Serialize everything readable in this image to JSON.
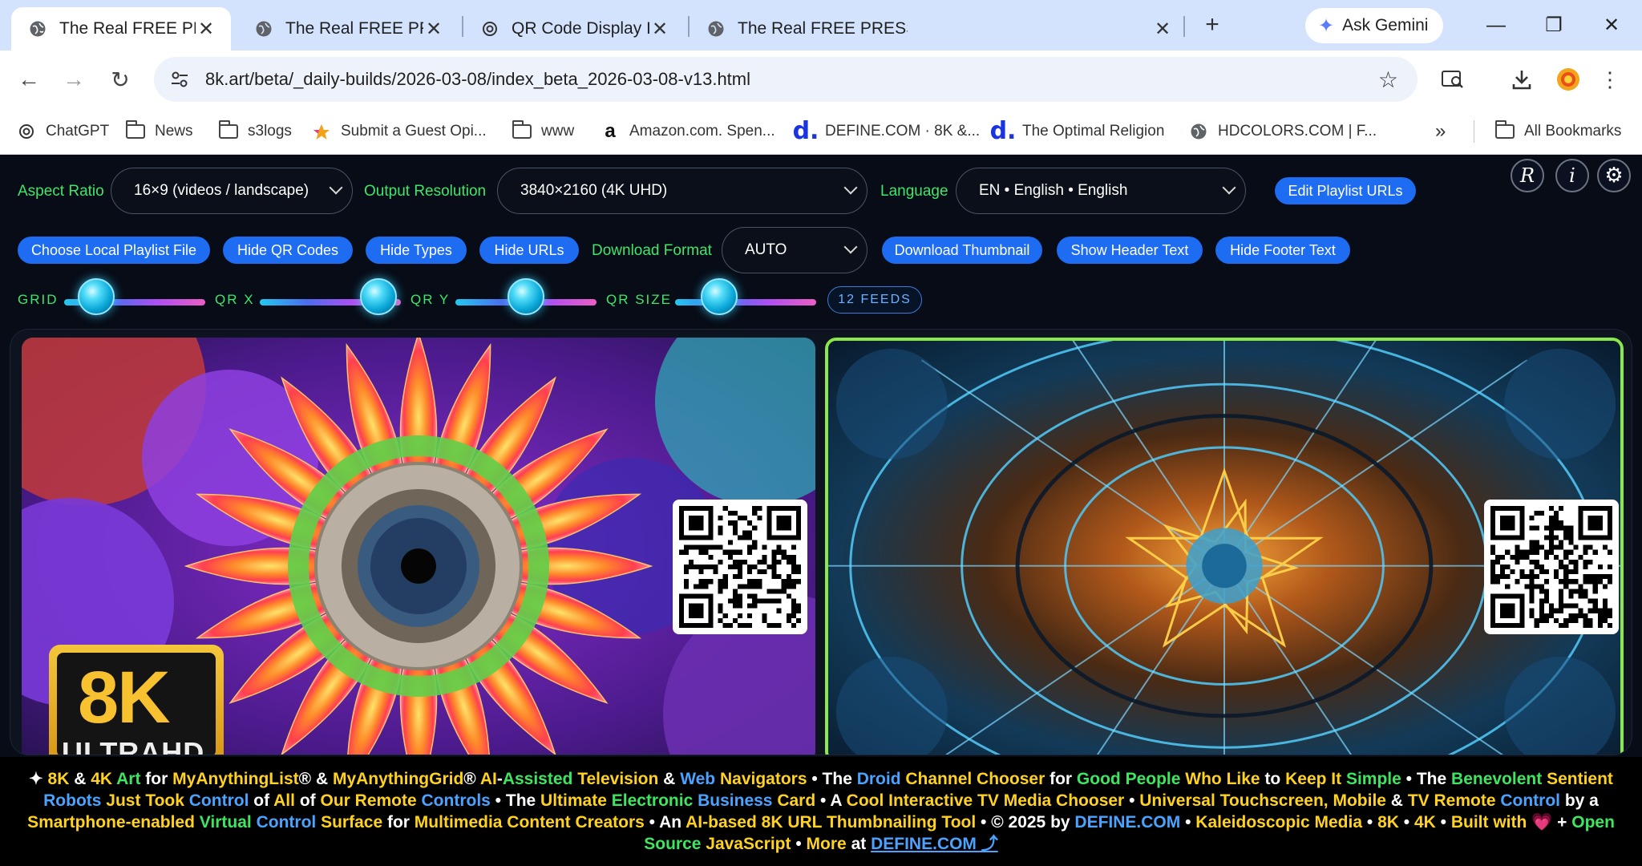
{
  "browser": {
    "tabs": [
      {
        "title": "The Real FREE PRESS",
        "active": true
      },
      {
        "title": "The Real FREE PRESS",
        "active": false
      },
      {
        "title": "QR Code Display Issue",
        "active": false
      },
      {
        "title": "The Real FREE PRESS",
        "active": false
      }
    ],
    "new_tab_label": "+",
    "gemini_label": "Ask Gemini",
    "url": "8k.art/beta/_daily-builds/2026-03-08/index_beta_2026-03-08-v13.html",
    "bookmarks": [
      {
        "label": "ChatGPT",
        "icon": "chatgpt-icon"
      },
      {
        "label": "News",
        "icon": "folder-icon"
      },
      {
        "label": "s3logs",
        "icon": "folder-icon"
      },
      {
        "label": "Submit a Guest Opi...",
        "icon": "bookmark-star-icon"
      },
      {
        "label": "www",
        "icon": "folder-icon"
      },
      {
        "label": "Amazon.com. Spen...",
        "icon": "amazon-icon"
      },
      {
        "label": "DEFINE.COM · 8K &...",
        "icon": "define-icon"
      },
      {
        "label": "The Optimal Religion",
        "icon": "define-icon"
      },
      {
        "label": "HDCOLORS.COM | F...",
        "icon": "globe-icon"
      }
    ],
    "overflow_label": "»",
    "all_bookmarks_label": "All Bookmarks"
  },
  "controls": {
    "aspect_ratio_label": "Aspect Ratio",
    "aspect_ratio_value": "16×9 (videos / landscape)",
    "output_resolution_label": "Output Resolution",
    "output_resolution_value": "3840×2160 (4K UHD)",
    "language_label": "Language",
    "language_value": "EN • English • English",
    "edit_playlist_label": "Edit Playlist URLs",
    "round_buttons": [
      "R",
      "i",
      "⚙"
    ],
    "choose_file_label": "Choose Local Playlist File",
    "hide_qr_label": "Hide QR Codes",
    "hide_types_label": "Hide Types",
    "hide_urls_label": "Hide URLs",
    "download_format_label": "Download Format",
    "download_format_value": "AUTO",
    "download_thumbnail_label": "Download Thumbnail",
    "show_header_label": "Show Header Text",
    "hide_footer_label": "Hide Footer Text",
    "sliders": [
      {
        "label": "GRID",
        "value": 0.18
      },
      {
        "label": "QR X",
        "value": 0.9
      },
      {
        "label": "QR Y",
        "value": 0.5
      },
      {
        "label": "QR SIZE",
        "value": 0.28
      }
    ],
    "feeds_label": "12 FEEDS"
  },
  "tiles": [
    {
      "badge_big": "8K",
      "badge_sub": "ULTRAHD"
    },
    {}
  ],
  "footer": {
    "segments": [
      {
        "t": "✦ ",
        "c": "w"
      },
      {
        "t": "8K",
        "c": "y"
      },
      {
        "t": " & ",
        "c": "w"
      },
      {
        "t": "4K",
        "c": "y"
      },
      {
        "t": " Art",
        "c": "g"
      },
      {
        "t": " for ",
        "c": "w"
      },
      {
        "t": "MyAnythingList",
        "c": "y"
      },
      {
        "t": "® & ",
        "c": "w"
      },
      {
        "t": "MyAnythingGrid",
        "c": "y"
      },
      {
        "t": "® ",
        "c": "w"
      },
      {
        "t": "AI",
        "c": "y"
      },
      {
        "t": "-",
        "c": "w"
      },
      {
        "t": "Assisted",
        "c": "g"
      },
      {
        "t": " Television",
        "c": "y"
      },
      {
        "t": " & ",
        "c": "w"
      },
      {
        "t": "Web",
        "c": "b"
      },
      {
        "t": " Navigators",
        "c": "y"
      },
      {
        "t": " • The ",
        "c": "w"
      },
      {
        "t": "Droid",
        "c": "b"
      },
      {
        "t": " Channel Chooser",
        "c": "y"
      },
      {
        "t": " for ",
        "c": "w"
      },
      {
        "t": "Good People",
        "c": "g"
      },
      {
        "t": " Who Like",
        "c": "y"
      },
      {
        "t": " to ",
        "c": "w"
      },
      {
        "t": "Keep It",
        "c": "y"
      },
      {
        "t": " Simple",
        "c": "g"
      },
      {
        "t": " • The ",
        "c": "w"
      },
      {
        "t": "Benevolent",
        "c": "g"
      },
      {
        "t": " Sentient ",
        "c": "y"
      },
      {
        "t": "Robots",
        "c": "b"
      },
      {
        "t": " Just Took ",
        "c": "y"
      },
      {
        "t": "Control",
        "c": "b"
      },
      {
        "t": " of ",
        "c": "w"
      },
      {
        "t": "All",
        "c": "y"
      },
      {
        "t": " of ",
        "c": "w"
      },
      {
        "t": "Our Remote ",
        "c": "y"
      },
      {
        "t": "Controls",
        "c": "b"
      },
      {
        "t": " • The ",
        "c": "w"
      },
      {
        "t": "Ultimate",
        "c": "y"
      },
      {
        "t": " Electronic",
        "c": "g"
      },
      {
        "t": " Business",
        "c": "b"
      },
      {
        "t": " Card",
        "c": "y"
      },
      {
        "t": " • A ",
        "c": "w"
      },
      {
        "t": "Cool Interactive TV Media Chooser",
        "c": "y"
      },
      {
        "t": " • ",
        "c": "w"
      },
      {
        "t": "Universal Touchscreen, Mobile",
        "c": "y"
      },
      {
        "t": " & ",
        "c": "w"
      },
      {
        "t": "TV Remote ",
        "c": "y"
      },
      {
        "t": "Control",
        "c": "b"
      },
      {
        "t": " by a ",
        "c": "w"
      },
      {
        "t": "Smartphone-enabled",
        "c": "y"
      },
      {
        "t": " Virtual",
        "c": "g"
      },
      {
        "t": " Control",
        "c": "b"
      },
      {
        "t": " Surface",
        "c": "y"
      },
      {
        "t": " for ",
        "c": "w"
      },
      {
        "t": "Multimedia Content Creators",
        "c": "y"
      },
      {
        "t": " • An ",
        "c": "w"
      },
      {
        "t": "AI-based 8K URL Thumbnailing Tool",
        "c": "y"
      },
      {
        "t": " • © 2025 by ",
        "c": "w"
      },
      {
        "t": "DEFINE.COM",
        "c": "b"
      },
      {
        "t": " • ",
        "c": "w"
      },
      {
        "t": "Kaleidoscopic Media",
        "c": "y"
      },
      {
        "t": " • ",
        "c": "w"
      },
      {
        "t": "8K",
        "c": "y"
      },
      {
        "t": " • ",
        "c": "w"
      },
      {
        "t": "4K",
        "c": "y"
      },
      {
        "t": " • ",
        "c": "w"
      },
      {
        "t": "Built with",
        "c": "y"
      },
      {
        "t": " 💗 + ",
        "c": "w"
      },
      {
        "t": "Open Source",
        "c": "g"
      },
      {
        "t": " JavaScript",
        "c": "y"
      },
      {
        "t": " • ",
        "c": "w"
      },
      {
        "t": "More",
        "c": "y"
      },
      {
        "t": " at ",
        "c": "w"
      },
      {
        "t": "DEFINE.COM ⤴",
        "c": "link"
      }
    ]
  }
}
